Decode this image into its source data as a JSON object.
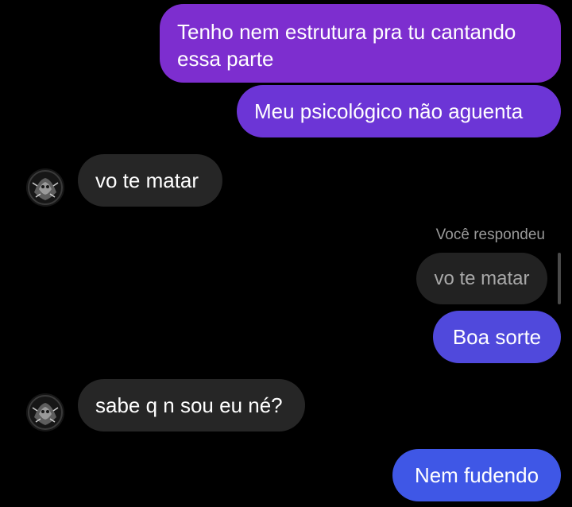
{
  "chat": {
    "messages": [
      {
        "from": "me",
        "text": "Tenho nem estrutura pra tu cantando essa parte"
      },
      {
        "from": "me",
        "text": "Meu psicológico não aguenta"
      },
      {
        "from": "them",
        "text": "vo te matar",
        "avatar": "contact-avatar"
      },
      {
        "from": "me",
        "reply_label": "Você respondeu",
        "quoted_text": "vo te matar",
        "text": "Boa sorte"
      },
      {
        "from": "them",
        "text": "sabe q n sou eu né?",
        "avatar": "contact-avatar"
      },
      {
        "from": "me",
        "text": "Nem fudendo"
      }
    ]
  },
  "colors": {
    "background": "#000000",
    "received_bubble": "#262626",
    "sent_gradient_top": "#7d2ecf",
    "sent_gradient_bottom": "#3f57e6"
  }
}
